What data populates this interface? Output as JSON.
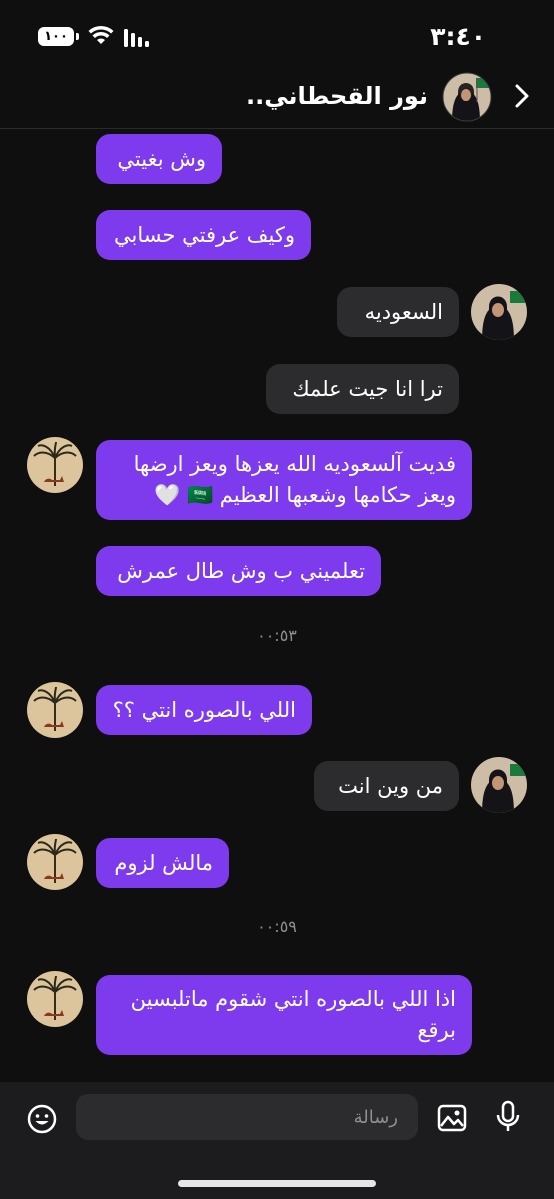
{
  "status": {
    "time": "٣:٤٠",
    "battery": "١٠٠"
  },
  "header": {
    "contact_name": "نور القحطاني.."
  },
  "messages": {
    "m1": {
      "text": "وش بغيتي"
    },
    "m2": {
      "text": "وكيف عرفتي حسابي"
    },
    "m3": {
      "text": "السعوديه"
    },
    "m4": {
      "text": "ترا انا جيت علمك"
    },
    "m5": {
      "line1": "فديت آلسعوديه الله يعزها ويعز ارضها",
      "line2": "ويعز حكامها وشعبها العظيم 🇸🇦 🤍"
    },
    "m6": {
      "text": "تعلميني ب وش طال عمرش"
    },
    "t1": "٠٠:٥٣",
    "m7": {
      "text": "اللي بالصوره انتي ؟؟"
    },
    "m8": {
      "text": "من وين انت"
    },
    "m9": {
      "text": "مالش لزوم"
    },
    "t2": "٠٠:٥٩",
    "m10": {
      "line1": "اذا اللي بالصوره انتي شقوم ماتلبسين",
      "line2": "برقع"
    }
  },
  "composer": {
    "placeholder": "رسالة"
  },
  "colors": {
    "sent_bubble": "#7d3bed",
    "received_bubble": "#2c2c2e",
    "background": "#0f0f10"
  },
  "icons": [
    "back-chevron-icon",
    "emoji-icon",
    "gallery-icon",
    "microphone-icon",
    "wifi-icon",
    "signal-icon",
    "battery-icon"
  ]
}
